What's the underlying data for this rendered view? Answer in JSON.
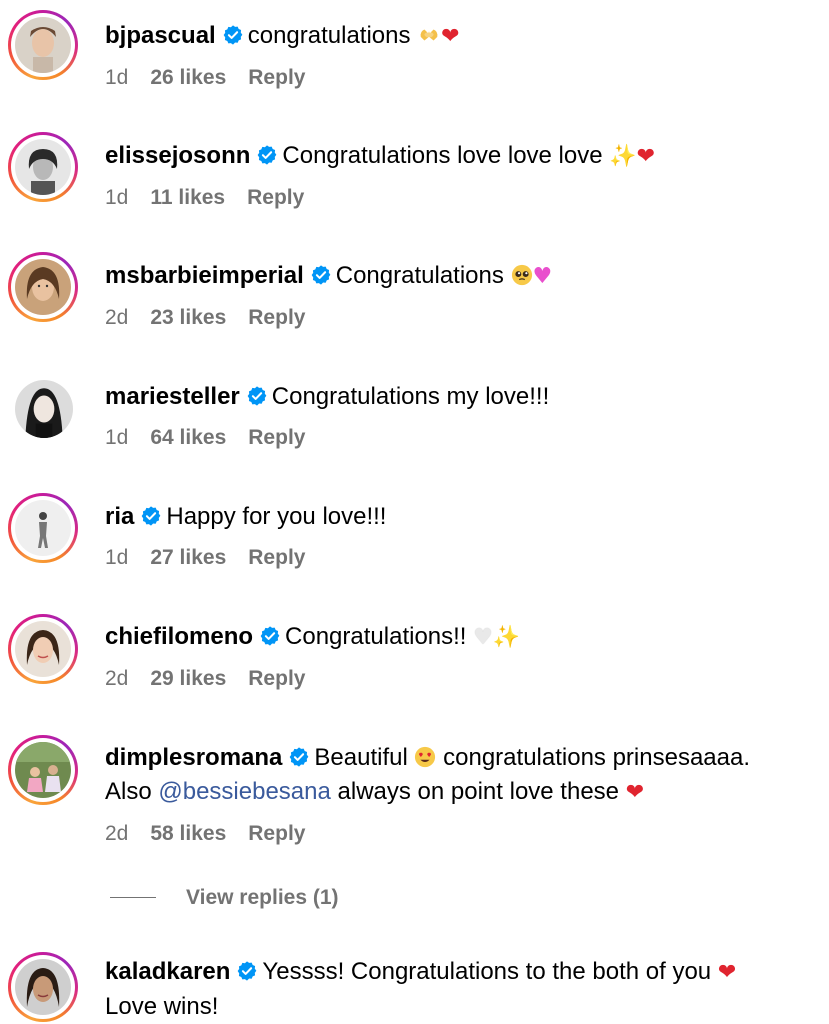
{
  "comments": [
    {
      "username": "bjpascual",
      "parts": [
        {
          "type": "text",
          "value": "congratulations "
        },
        {
          "type": "emoji",
          "value": "🫶"
        },
        {
          "type": "emoji",
          "value": "❤"
        }
      ],
      "time": "1d",
      "likes": "26 likes",
      "reply": "Reply"
    },
    {
      "username": "elissejosonn",
      "parts": [
        {
          "type": "text",
          "value": "Congratulations love love love "
        },
        {
          "type": "emoji",
          "value": "✨"
        },
        {
          "type": "emoji",
          "value": "❤"
        }
      ],
      "time": "1d",
      "likes": "11 likes",
      "reply": "Reply"
    },
    {
      "username": "msbarbieimperial",
      "parts": [
        {
          "type": "text",
          "value": "Congratulations "
        },
        {
          "type": "emoji",
          "value": "🥺"
        },
        {
          "type": "emoji",
          "value": "💗"
        }
      ],
      "time": "2d",
      "likes": "23 likes",
      "reply": "Reply"
    },
    {
      "username": "mariesteller",
      "parts": [
        {
          "type": "text",
          "value": "Congratulations my love!!!"
        }
      ],
      "time": "1d",
      "likes": "64 likes",
      "reply": "Reply"
    },
    {
      "username": "ria",
      "parts": [
        {
          "type": "text",
          "value": "Happy for you love!!!"
        }
      ],
      "time": "1d",
      "likes": "27 likes",
      "reply": "Reply"
    },
    {
      "username": "chiefilomeno",
      "parts": [
        {
          "type": "text",
          "value": "Congratulations!! "
        },
        {
          "type": "emoji",
          "value": "🤍"
        },
        {
          "type": "emoji",
          "value": "✨"
        }
      ],
      "time": "2d",
      "likes": "29 likes",
      "reply": "Reply"
    },
    {
      "username": "dimplesromana",
      "line1_before": "Beautiful ",
      "line1_emoji": "😍",
      "line1_after": " congratulations prinsesaaaa.",
      "line2_before": "Also ",
      "mention": "@bessiebesana",
      "line2_after": " always on point love these ",
      "line2_emoji": "❤",
      "time": "2d",
      "likes": "58 likes",
      "reply": "Reply"
    },
    {
      "username": "kaladkaren",
      "line1_text": "Yessss! Congratulations to the both of you ",
      "line1_emoji": "❤",
      "line2_text": "Love wins!"
    }
  ],
  "view_replies": "View replies (1)",
  "colors": {
    "meta_gray": "#737373",
    "verified_blue": "#0095f6",
    "mention_blue": "#3a5a9c",
    "heart_red": "#e0242f"
  },
  "icons": {
    "verified": "verified-badge-icon"
  }
}
